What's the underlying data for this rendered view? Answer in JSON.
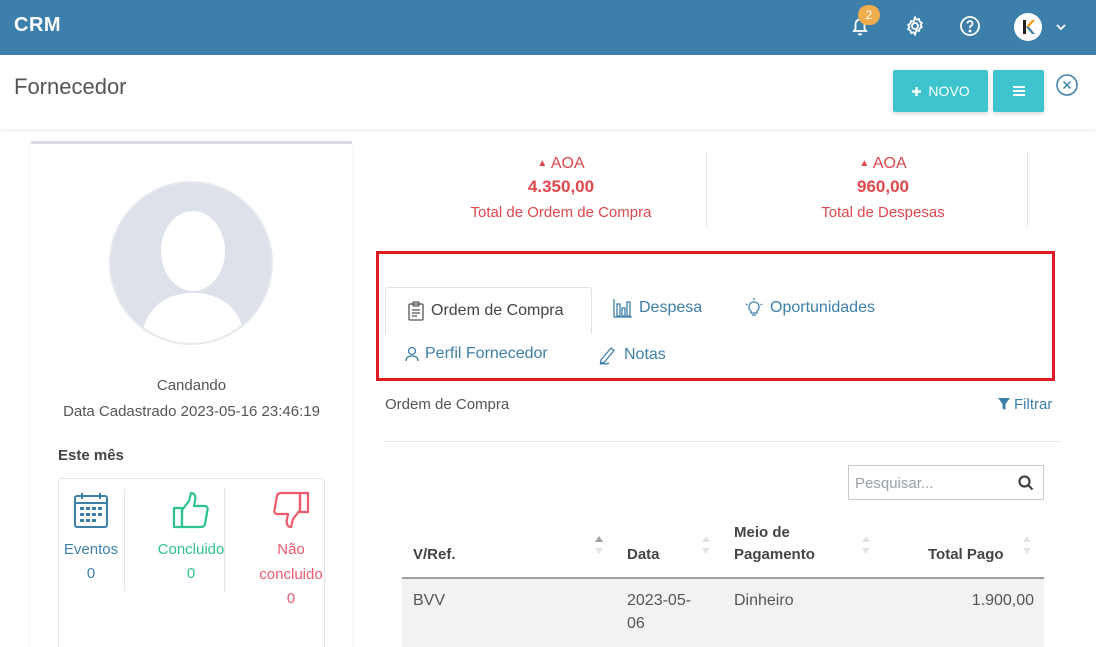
{
  "app": {
    "brand": "CRM",
    "notification_count": "2"
  },
  "header": {
    "title": "Fornecedor",
    "new_button": "NOVO"
  },
  "profile": {
    "name": "Candando",
    "registered": "Data Cadastrado 2023-05-16 23:46:19",
    "month_label": "Este mês",
    "stats": [
      {
        "label": "Eventos",
        "value": "0",
        "icon": "calendar-icon"
      },
      {
        "label": "Concluido",
        "value": "0",
        "icon": "thumbs-up-icon"
      },
      {
        "label": "Não concluido",
        "value": "0",
        "icon": "thumbs-down-icon"
      }
    ]
  },
  "totals": [
    {
      "currency": "AOA",
      "amount": "4.350,00",
      "label": "Total de Ordem de Compra"
    },
    {
      "currency": "AOA",
      "amount": "960,00",
      "label": "Total de Despesas"
    }
  ],
  "tabs": [
    {
      "label": "Ordem de Compra",
      "icon": "clipboard-icon",
      "active": true
    },
    {
      "label": "Despesa",
      "icon": "bar-chart-icon"
    },
    {
      "label": "Oportunidades",
      "icon": "lightbulb-icon"
    },
    {
      "label": "Perfil Fornecedor",
      "icon": "user-icon"
    },
    {
      "label": "Notas",
      "icon": "pen-icon"
    }
  ],
  "section": {
    "title": "Ordem de Compra",
    "filter": "Filtrar",
    "search_placeholder": "Pesquisar..."
  },
  "table": {
    "columns": [
      "V/Ref.",
      "Data",
      "Meio de Pagamento",
      "Total Pago"
    ],
    "rows": [
      {
        "ref": "BVV",
        "date": "2023-05-06",
        "method": "Dinheiro",
        "total": "1.900,00"
      }
    ]
  },
  "colors": {
    "topbar": "#3d7fab",
    "accent": "#3dc4cf",
    "totals": "#e0474c",
    "highlight": "#e01b24"
  }
}
